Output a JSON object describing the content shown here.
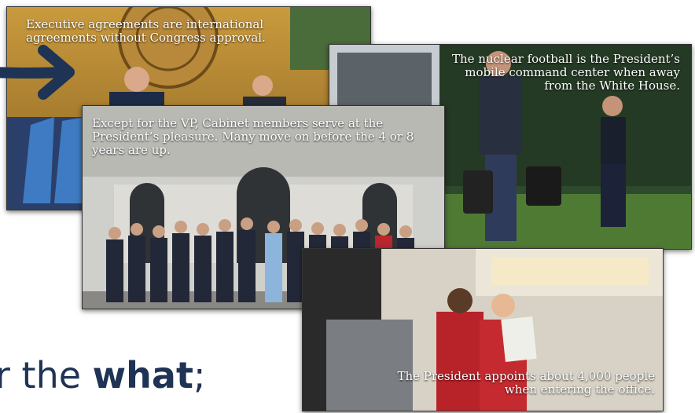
{
  "cards": {
    "un": {
      "caption": "Executive agreements are international agreements without Congress approval."
    },
    "football": {
      "caption": "The nuclear football is the President’s mobile command center when away from the White House."
    },
    "cabinet": {
      "caption": "Except for the VP, Cabinet members serve at the President’s pleasure. Many move on before the 4 or 8 years are up."
    },
    "appointments": {
      "caption": "The President appoints about 4,000 people when entering the office."
    }
  },
  "bottom": {
    "pre": "r the ",
    "bold1": "what",
    "post": ";"
  },
  "colors": {
    "arrow": "#1f3354",
    "text": "#1f3354"
  },
  "icons": {
    "arrow": "arrow-right-icon"
  }
}
